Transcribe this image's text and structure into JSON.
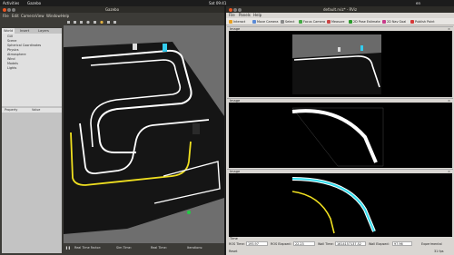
{
  "topbar": {
    "activities": "Activities",
    "app": "Gazebo",
    "clock": "Sat 09:41",
    "lang": "en"
  },
  "gazebo": {
    "title": "Gazebo",
    "menu": [
      "File",
      "Edit",
      "Camera",
      "View",
      "Window",
      "Help"
    ],
    "tabs": [
      "World",
      "Insert",
      "Layers"
    ],
    "tree": [
      "GUI",
      "Scene",
      "Spherical Coordinates",
      "Physics",
      "Atmosphere",
      "Wind",
      "Models",
      "Lights"
    ],
    "prop_header": {
      "property": "Property",
      "value": "Value"
    },
    "status": {
      "real_time_factor": "Real Time Factor:",
      "sim_time": "Sim Time:",
      "real_time": "Real Time:",
      "iterations": "Iterations:"
    }
  },
  "rviz": {
    "title": "default.rviz* - RViz",
    "menu": [
      "File",
      "Panels",
      "Help"
    ],
    "tools": [
      {
        "label": "Interact",
        "color": "#e8a020"
      },
      {
        "label": "Move Camera",
        "color": "#5a8ad6"
      },
      {
        "label": "Select",
        "color": "#8a8a8a"
      },
      {
        "label": "Focus Camera",
        "color": "#44aa44"
      },
      {
        "label": "Measure",
        "color": "#cc4444"
      },
      {
        "label": "2D Pose Estimate",
        "color": "#2a9a2a"
      },
      {
        "label": "2D Nav Goal",
        "color": "#c83a8a"
      },
      {
        "label": "Publish Point",
        "color": "#d63838"
      }
    ],
    "image_panels": [
      "Image",
      "Image",
      "Image"
    ],
    "time_panel": "Time",
    "time": {
      "ros_time_label": "ROS Time:",
      "ros_time": "195.97",
      "ros_elapsed_label": "ROS Elapsed:",
      "ros_elapsed": "22.23",
      "wall_time_label": "Wall Time:",
      "wall_time": "1614157137.52",
      "wall_elapsed_label": "Wall Elapsed:",
      "wall_elapsed": "97.96",
      "mode": "Experimental"
    },
    "footer": {
      "reset": "Reset",
      "fps": "31 fps"
    }
  }
}
